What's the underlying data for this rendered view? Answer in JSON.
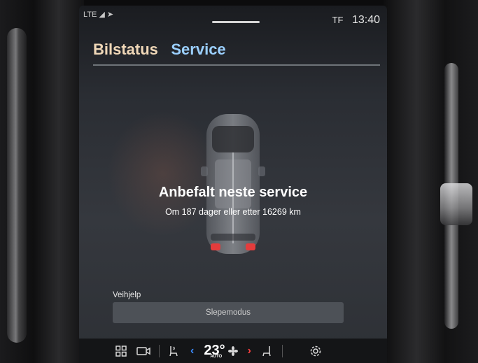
{
  "status_bar": {
    "left": "LTE",
    "network": "TF",
    "time": "13:40"
  },
  "tabs": [
    {
      "label": "Bilstatus"
    },
    {
      "label": "Service"
    }
  ],
  "service": {
    "title": "Anbefalt neste service",
    "subtitle": "Om 187 dager eller etter 16269 km"
  },
  "assistance": {
    "section_label": "Veihjelp",
    "button_label": "Slepemodus"
  },
  "climate_bar": {
    "temperature": "23°",
    "temperature_mode": "AUTO"
  },
  "colors": {
    "tab_inactive": "#f0d8b8",
    "tab_active": "#9bd0ff",
    "arrow_down": "#3b8cff",
    "arrow_up": "#ff4040"
  },
  "icons": [
    "apps-grid-icon",
    "camera-icon",
    "seat-heat-left-icon",
    "chevron-left-icon",
    "fan-icon",
    "chevron-right-icon",
    "seat-heat-right-icon",
    "settings-gear-icon"
  ]
}
